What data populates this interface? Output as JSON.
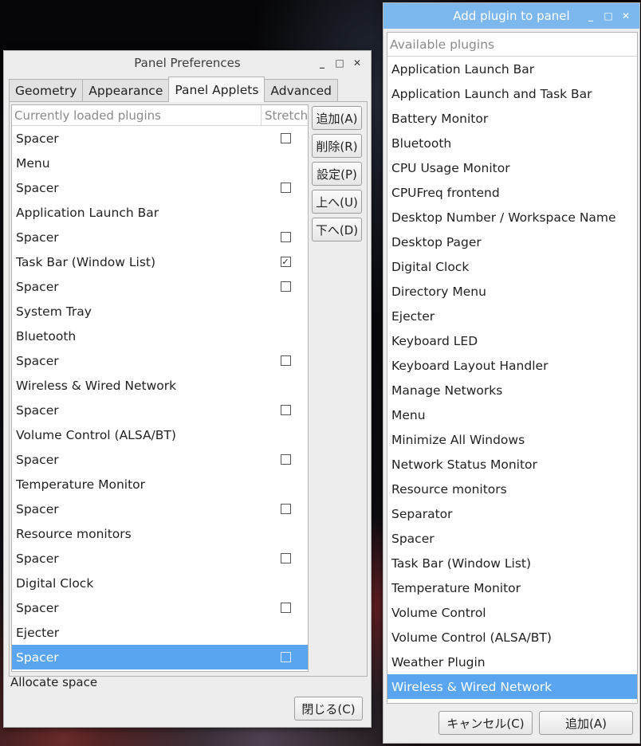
{
  "prefs": {
    "title": "Panel Preferences",
    "tabs": [
      {
        "label": "Geometry",
        "active": false
      },
      {
        "label": "Appearance",
        "active": false
      },
      {
        "label": "Panel Applets",
        "active": true
      },
      {
        "label": "Advanced",
        "active": false
      }
    ],
    "list_header": {
      "name": "Currently loaded plugins",
      "stretch": "Stretch"
    },
    "plugins": [
      {
        "name": "Spacer",
        "has_checkbox": true,
        "checked": false
      },
      {
        "name": "Menu",
        "has_checkbox": false,
        "checked": false
      },
      {
        "name": "Spacer",
        "has_checkbox": true,
        "checked": false
      },
      {
        "name": "Application Launch Bar",
        "has_checkbox": false,
        "checked": false
      },
      {
        "name": "Spacer",
        "has_checkbox": true,
        "checked": false
      },
      {
        "name": "Task Bar (Window List)",
        "has_checkbox": true,
        "checked": true
      },
      {
        "name": "Spacer",
        "has_checkbox": true,
        "checked": false
      },
      {
        "name": "System Tray",
        "has_checkbox": false,
        "checked": false
      },
      {
        "name": "Bluetooth",
        "has_checkbox": false,
        "checked": false
      },
      {
        "name": "Spacer",
        "has_checkbox": true,
        "checked": false
      },
      {
        "name": "Wireless & Wired Network",
        "has_checkbox": false,
        "checked": false
      },
      {
        "name": "Spacer",
        "has_checkbox": true,
        "checked": false
      },
      {
        "name": "Volume Control (ALSA/BT)",
        "has_checkbox": false,
        "checked": false
      },
      {
        "name": "Spacer",
        "has_checkbox": true,
        "checked": false
      },
      {
        "name": "Temperature Monitor",
        "has_checkbox": false,
        "checked": false
      },
      {
        "name": "Spacer",
        "has_checkbox": true,
        "checked": false
      },
      {
        "name": "Resource monitors",
        "has_checkbox": false,
        "checked": false
      },
      {
        "name": "Spacer",
        "has_checkbox": true,
        "checked": false
      },
      {
        "name": "Digital Clock",
        "has_checkbox": false,
        "checked": false
      },
      {
        "name": "Spacer",
        "has_checkbox": true,
        "checked": false
      },
      {
        "name": "Ejecter",
        "has_checkbox": false,
        "checked": false
      },
      {
        "name": "Spacer",
        "has_checkbox": true,
        "checked": false,
        "selected": true
      }
    ],
    "side_buttons": {
      "add": "追加(A)",
      "remove": "削除(R)",
      "settings": "設定(P)",
      "up": "上へ(U)",
      "down": "下へ(D)"
    },
    "status": "Allocate space",
    "close": "閉じる(C)"
  },
  "add_plugin": {
    "title": "Add plugin to panel",
    "list_header": "Available plugins",
    "plugins": [
      "Application Launch Bar",
      "Application Launch and Task Bar",
      "Battery Monitor",
      "Bluetooth",
      "CPU Usage Monitor",
      "CPUFreq frontend",
      "Desktop Number / Workspace Name",
      "Desktop Pager",
      "Digital Clock",
      "Directory Menu",
      "Ejecter",
      "Keyboard LED",
      "Keyboard Layout Handler",
      "Manage Networks",
      "Menu",
      "Minimize All Windows",
      "Network Status Monitor",
      "Resource monitors",
      "Separator",
      "Spacer",
      "Task Bar (Window List)",
      "Temperature Monitor",
      "Volume Control",
      "Volume Control (ALSA/BT)",
      "Weather Plugin",
      "Wireless & Wired Network"
    ],
    "selected_index": 25,
    "cancel": "キャンセル(C)",
    "add": "追加(A)"
  },
  "titlebar_controls": {
    "minimize": "_",
    "maximize": "□",
    "close": "✕"
  },
  "colors": {
    "selection": "#5aa5ef",
    "active_titlebar": "#7cb8ee"
  }
}
